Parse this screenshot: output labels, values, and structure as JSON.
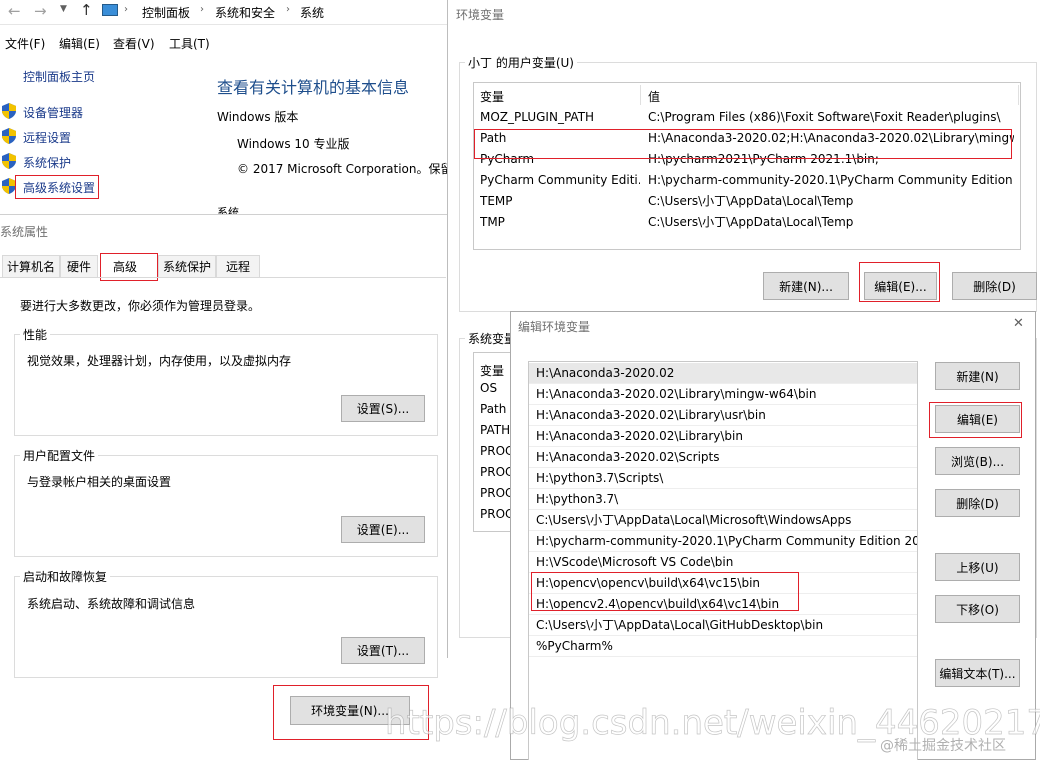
{
  "explorer": {
    "breadcrumb": [
      "控制面板",
      "系统和安全",
      "系统"
    ],
    "menu": [
      "文件(F)",
      "编辑(E)",
      "查看(V)",
      "工具(T)"
    ],
    "home_link": "控制面板主页",
    "sidebar": [
      "设备管理器",
      "远程设置",
      "系统保护",
      "高级系统设置"
    ],
    "main_title": "查看有关计算机的基本信息",
    "windows_version_label": "Windows 版本",
    "windows_edition": "Windows 10 专业版",
    "copyright": "© 2017 Microsoft Corporation。保留",
    "system_label": "系统"
  },
  "sysprops": {
    "title": "系统属性",
    "tabs": [
      "计算机名",
      "硬件",
      "高级",
      "系统保护",
      "远程"
    ],
    "admin_note": "要进行大多数更改，你必须作为管理员登录。",
    "performance": {
      "title": "性能",
      "desc": "视觉效果，处理器计划，内存使用，以及虚拟内存",
      "button": "设置(S)..."
    },
    "user_profiles": {
      "title": "用户配置文件",
      "desc": "与登录帐户相关的桌面设置",
      "button": "设置(E)..."
    },
    "startup": {
      "title": "启动和故障恢复",
      "desc": "系统启动、系统故障和调试信息",
      "button": "设置(T)..."
    },
    "env_button": "环境变量(N)..."
  },
  "envvars": {
    "title": "环境变量",
    "user_group": "小丁 的用户变量(U)",
    "col_var": "变量",
    "col_val": "值",
    "user_rows": [
      {
        "name": "MOZ_PLUGIN_PATH",
        "value": "C:\\Program Files (x86)\\Foxit Software\\Foxit Reader\\plugins\\"
      },
      {
        "name": "Path",
        "value": "H:\\Anaconda3-2020.02;H:\\Anaconda3-2020.02\\Library\\mingw..."
      },
      {
        "name": "PyCharm",
        "value": "H:\\pycharm2021\\PyCharm 2021.1\\bin;"
      },
      {
        "name": "PyCharm Community Editi...",
        "value": "H:\\pycharm-community-2020.1\\PyCharm Community Edition ..."
      },
      {
        "name": "TEMP",
        "value": "C:\\Users\\小丁\\AppData\\Local\\Temp"
      },
      {
        "name": "TMP",
        "value": "C:\\Users\\小丁\\AppData\\Local\\Temp"
      }
    ],
    "new_button": "新建(N)...",
    "edit_button": "编辑(E)...",
    "delete_button": "删除(D)",
    "system_group": "系统变量",
    "system_rows": [
      "OS",
      "Path",
      "PATH",
      "PROC",
      "PROC",
      "PROC",
      "PROC"
    ]
  },
  "editenv": {
    "title": "编辑环境变量",
    "close_glyph": "✕",
    "paths": [
      "H:\\Anaconda3-2020.02",
      "H:\\Anaconda3-2020.02\\Library\\mingw-w64\\bin",
      "H:\\Anaconda3-2020.02\\Library\\usr\\bin",
      "H:\\Anaconda3-2020.02\\Library\\bin",
      "H:\\Anaconda3-2020.02\\Scripts",
      "H:\\python3.7\\Scripts\\",
      "H:\\python3.7\\",
      "C:\\Users\\小丁\\AppData\\Local\\Microsoft\\WindowsApps",
      "H:\\pycharm-community-2020.1\\PyCharm Community Edition 20...",
      "H:\\VScode\\Microsoft VS Code\\bin",
      "H:\\opencv\\opencv\\build\\x64\\vc15\\bin",
      "H:\\opencv2.4\\opencv\\build\\x64\\vc14\\bin",
      "C:\\Users\\小丁\\AppData\\Local\\GitHubDesktop\\bin",
      "%PyCharm%"
    ],
    "buttons": {
      "new": "新建(N)",
      "edit": "编辑(E)",
      "browse": "浏览(B)...",
      "delete": "删除(D)",
      "up": "上移(U)",
      "down": "下移(O)",
      "edit_text": "编辑文本(T)..."
    }
  },
  "watermark": "https://blog.csdn.net/weixin_44620217",
  "credit": "@稀土掘金技术社区",
  "colors": {
    "highlight": "#e0202a",
    "link": "#0066cc",
    "title_blue": "#1e4e8c"
  }
}
